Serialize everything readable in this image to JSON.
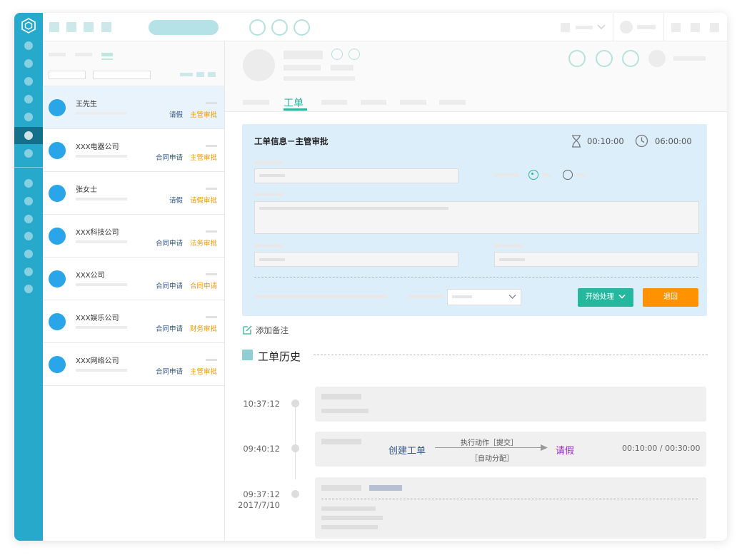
{
  "colors": {
    "rail": "#26a9cb",
    "accent": "#2db39c",
    "orange": "#f39800",
    "blue_link": "#34558a",
    "panel": "#ddeefb",
    "purple": "#9a26d8"
  },
  "list": {
    "items": [
      {
        "name": "王先生",
        "type": "请假",
        "status": "主管审批"
      },
      {
        "name": "XXX电器公司",
        "type": "合同申请",
        "status": "主管审批"
      },
      {
        "name": "张女士",
        "type": "请假",
        "status": "请假审批"
      },
      {
        "name": "XXX科技公司",
        "type": "合同申请",
        "status": "法务审批"
      },
      {
        "name": "XXX公司",
        "type": "合同申请",
        "status": "合同申请"
      },
      {
        "name": "XXX娱乐公司",
        "type": "合同申请",
        "status": "财务审批"
      },
      {
        "name": "XXX网络公司",
        "type": "合同申请",
        "status": "主管审批"
      }
    ]
  },
  "tabs": {
    "active": "工单"
  },
  "panel": {
    "title": "工单信息－主管审批",
    "elapsed": "00:10:00",
    "limit": "06:00:00",
    "start_label": "开始处理",
    "back_label": "退回"
  },
  "note_label": "添加备注",
  "history": {
    "title": "工单历史",
    "entries": [
      {
        "time": "10:37:12",
        "date": ""
      },
      {
        "time": "09:40:12",
        "date": "",
        "from": "创建工单",
        "action": "执行动作［提交］",
        "assign": "［自动分配］",
        "to": "请假",
        "duration": "00:10:00 / 00:30:00"
      },
      {
        "time": "09:37:12",
        "date": "2017/7/10"
      }
    ]
  }
}
